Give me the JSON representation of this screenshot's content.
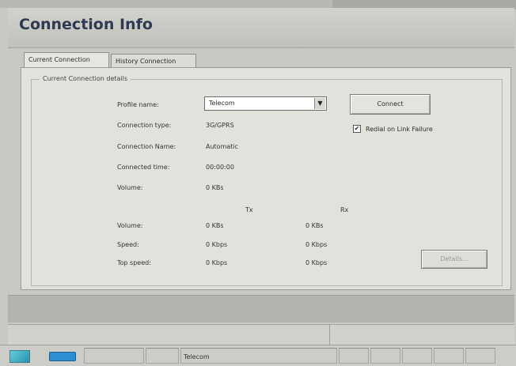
{
  "window": {
    "title": "Connection Info"
  },
  "tabs": [
    {
      "label": "Current Connection",
      "active": true
    },
    {
      "label": "History Connection",
      "active": false
    }
  ],
  "group": {
    "legend": "Current Connection details"
  },
  "details": {
    "profile_label": "Profile name:",
    "profile_value": "Telecom",
    "type_label": "Connection type:",
    "type_value": "3G/GPRS",
    "name_label": "Connection Name:",
    "name_value": "Automatic",
    "time_label": "Connected time:",
    "time_value": "00:00:00",
    "volume_label": "Volume:",
    "volume_value": "0 KBs"
  },
  "buttons": {
    "connect": "Connect",
    "details": "Details..."
  },
  "checkbox": {
    "label": "Redial on Link Failure",
    "checked": true,
    "mark": "✔"
  },
  "columns": {
    "tx": "Tx",
    "rx": "Rx"
  },
  "stats": [
    {
      "label": "Volume:",
      "tx": "0 KBs",
      "rx": "0 KBs"
    },
    {
      "label": "Speed:",
      "tx": "0 Kbps",
      "rx": "0 Kbps"
    },
    {
      "label": "Top speed:",
      "tx": "0 Kbps",
      "rx": "0 Kbps"
    }
  ],
  "dropdown_arrow": "▼",
  "statusbar": {
    "profile": "Telecom"
  },
  "icons": {
    "network": "network-status-icon",
    "signal": "signal-icon"
  }
}
